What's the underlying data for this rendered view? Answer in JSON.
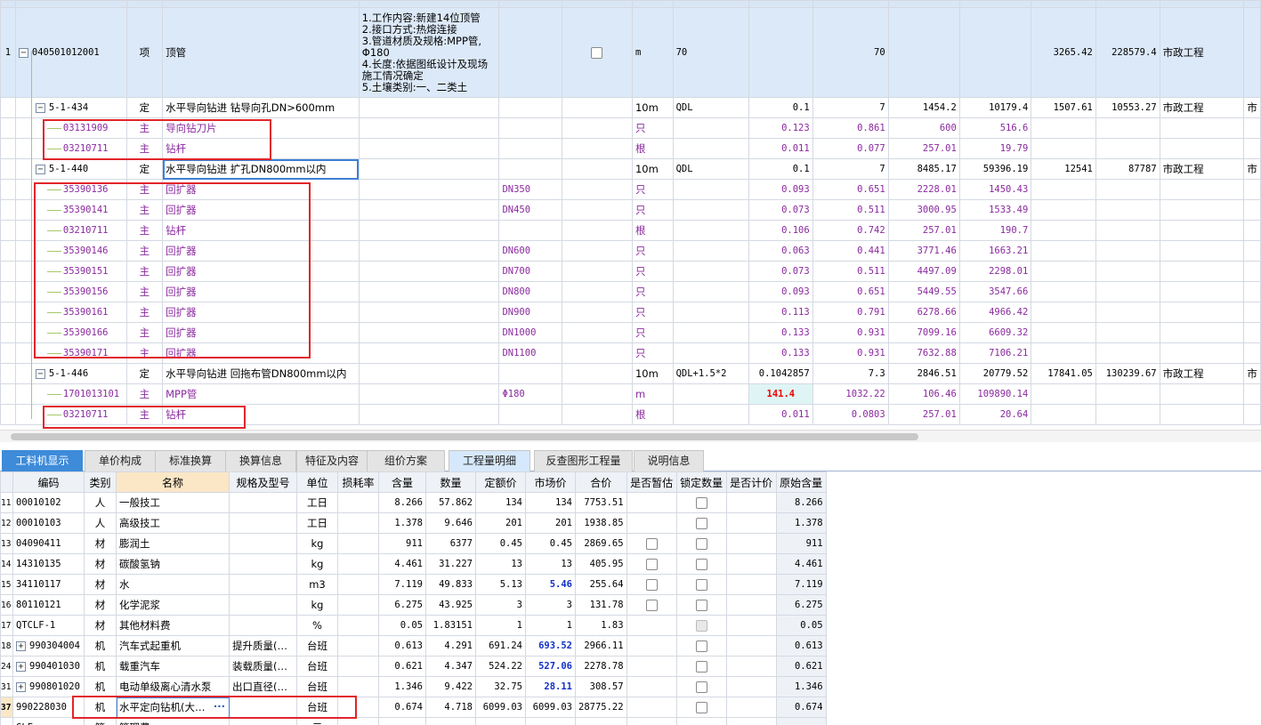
{
  "upper": {
    "main_row": {
      "idx": "1",
      "code": "040501012001",
      "type": "项",
      "name": "顶管",
      "desc": "1.工作内容:新建14位顶管\n2.接口方式:热熔连接\n3.管道材质及规格:MPP管,\nΦ180\n4.长度:依据图纸设计及现场\n施工情况确定\n5.土壤类别:一、二类土",
      "unit": "m",
      "expr": "70",
      "qty": "70",
      "p1": "3265.42",
      "p2": "228579.4",
      "cat": "市政工程"
    },
    "rows": [
      {
        "kind": "ding",
        "code": "5-1-434",
        "type": "定",
        "name": "水平导向钻进 钻导向孔DN>600mm",
        "spec": "",
        "unit": "10m",
        "expr": "QDL",
        "c1": "0.1",
        "c2": "7",
        "c3": "1454.2",
        "c4": "10179.4",
        "c5": "1507.61",
        "c6": "10553.27",
        "c7": "市政工程",
        "c8": "市"
      },
      {
        "kind": "zhu",
        "code": "03131909",
        "type": "主",
        "name": "导向钻刀片",
        "spec": "",
        "unit": "只",
        "c1": "0.123",
        "c2": "0.861",
        "c3": "600",
        "c4": "516.6"
      },
      {
        "kind": "zhu",
        "code": "03210711",
        "type": "主",
        "name": "钻杆",
        "spec": "",
        "unit": "根",
        "c1": "0.011",
        "c2": "0.077",
        "c3": "257.01",
        "c4": "19.79"
      },
      {
        "kind": "ding",
        "code": "5-1-440",
        "type": "定",
        "name": "水平导向钻进 扩孔DN800mm以内",
        "spec": "",
        "unit": "10m",
        "expr": "QDL",
        "c1": "0.1",
        "c2": "7",
        "c3": "8485.17",
        "c4": "59396.19",
        "c5": "12541",
        "c6": "87787",
        "c7": "市政工程",
        "c8": "市"
      },
      {
        "kind": "zhu",
        "code": "35390136",
        "type": "主",
        "name": "回扩器",
        "spec": "DN350",
        "unit": "只",
        "c1": "0.093",
        "c2": "0.651",
        "c3": "2228.01",
        "c4": "1450.43"
      },
      {
        "kind": "zhu",
        "code": "35390141",
        "type": "主",
        "name": "回扩器",
        "spec": "DN450",
        "unit": "只",
        "c1": "0.073",
        "c2": "0.511",
        "c3": "3000.95",
        "c4": "1533.49"
      },
      {
        "kind": "zhu",
        "code": "03210711",
        "type": "主",
        "name": "钻杆",
        "spec": "",
        "unit": "根",
        "c1": "0.106",
        "c2": "0.742",
        "c3": "257.01",
        "c4": "190.7"
      },
      {
        "kind": "zhu",
        "code": "35390146",
        "type": "主",
        "name": "回扩器",
        "spec": "DN600",
        "unit": "只",
        "c1": "0.063",
        "c2": "0.441",
        "c3": "3771.46",
        "c4": "1663.21"
      },
      {
        "kind": "zhu",
        "code": "35390151",
        "type": "主",
        "name": "回扩器",
        "spec": "DN700",
        "unit": "只",
        "c1": "0.073",
        "c2": "0.511",
        "c3": "4497.09",
        "c4": "2298.01"
      },
      {
        "kind": "zhu",
        "code": "35390156",
        "type": "主",
        "name": "回扩器",
        "spec": "DN800",
        "unit": "只",
        "c1": "0.093",
        "c2": "0.651",
        "c3": "5449.55",
        "c4": "3547.66"
      },
      {
        "kind": "zhu",
        "code": "35390161",
        "type": "主",
        "name": "回扩器",
        "spec": "DN900",
        "unit": "只",
        "c1": "0.113",
        "c2": "0.791",
        "c3": "6278.66",
        "c4": "4966.42"
      },
      {
        "kind": "zhu",
        "code": "35390166",
        "type": "主",
        "name": "回扩器",
        "spec": "DN1000",
        "unit": "只",
        "c1": "0.133",
        "c2": "0.931",
        "c3": "7099.16",
        "c4": "6609.32"
      },
      {
        "kind": "zhu",
        "code": "35390171",
        "type": "主",
        "name": "回扩器",
        "spec": "DN1100",
        "unit": "只",
        "c1": "0.133",
        "c2": "0.931",
        "c3": "7632.88",
        "c4": "7106.21"
      },
      {
        "kind": "ding",
        "code": "5-1-446",
        "type": "定",
        "name": "水平导向钻进 回拖布管DN800mm以内",
        "spec": "",
        "unit": "10m",
        "expr": "QDL+1.5*2",
        "c1": "0.1042857",
        "c2": "7.3",
        "c3": "2846.51",
        "c4": "20779.52",
        "c5": "17841.05",
        "c6": "130239.67",
        "c7": "市政工程",
        "c8": "市"
      },
      {
        "kind": "zhu",
        "code": "1701013101",
        "type": "主",
        "name": "MPP管",
        "spec": "Φ180",
        "unit": "m",
        "c1": "141.4",
        "c2": "1032.22",
        "c3": "106.46",
        "c4": "109890.14",
        "hl": true
      },
      {
        "kind": "zhu",
        "code": "03210711",
        "type": "主",
        "name": "钻杆",
        "spec": "",
        "unit": "根",
        "c1": "0.011",
        "c2": "0.0803",
        "c3": "257.01",
        "c4": "20.64"
      }
    ]
  },
  "tabs": [
    "工料机显示",
    "单价构成",
    "标准换算",
    "换算信息",
    "特征及内容",
    "组价方案",
    "工程量明细",
    "反查图形工程量",
    "说明信息"
  ],
  "lower": {
    "headers": [
      "编码",
      "类别",
      "名称",
      "规格及型号",
      "单位",
      "损耗率",
      "含量",
      "数量",
      "定额价",
      "市场价",
      "合价",
      "是否暂估",
      "锁定数量",
      "是否计价",
      "原始含量"
    ],
    "rows": [
      {
        "no": "11",
        "code": "00010102",
        "cat": "人",
        "name": "一般技工",
        "spec": "",
        "unit": "工日",
        "qty": "8.266",
        "num": "57.862",
        "dp": "134",
        "mp": "134",
        "total": "7753.51",
        "zg": false,
        "sd": true,
        "orig": "8.266"
      },
      {
        "no": "12",
        "code": "00010103",
        "cat": "人",
        "name": "高级技工",
        "spec": "",
        "unit": "工日",
        "qty": "1.378",
        "num": "9.646",
        "dp": "201",
        "mp": "201",
        "total": "1938.85",
        "zg": false,
        "sd": true,
        "orig": "1.378"
      },
      {
        "no": "13",
        "code": "04090411",
        "cat": "材",
        "name": "膨润土",
        "spec": "",
        "unit": "kg",
        "qty": "911",
        "num": "6377",
        "dp": "0.45",
        "mp": "0.45",
        "total": "2869.65",
        "zg": true,
        "sd": true,
        "orig": "911"
      },
      {
        "no": "14",
        "code": "14310135",
        "cat": "材",
        "name": "碳酸氢钠",
        "spec": "",
        "unit": "kg",
        "qty": "4.461",
        "num": "31.227",
        "dp": "13",
        "mp": "13",
        "total": "405.95",
        "zg": true,
        "sd": true,
        "orig": "4.461"
      },
      {
        "no": "15",
        "code": "34110117",
        "cat": "材",
        "name": "水",
        "spec": "",
        "unit": "m3",
        "qty": "7.119",
        "num": "49.833",
        "dp": "5.13",
        "mp": "5.46",
        "total": "255.64",
        "zg": true,
        "sd": true,
        "orig": "7.119",
        "blue": true
      },
      {
        "no": "16",
        "code": "80110121",
        "cat": "材",
        "name": "化学泥浆",
        "spec": "",
        "unit": "kg",
        "qty": "6.275",
        "num": "43.925",
        "dp": "3",
        "mp": "3",
        "total": "131.78",
        "zg": true,
        "sd": true,
        "orig": "6.275"
      },
      {
        "no": "17",
        "code": "QTCLF-1",
        "cat": "材",
        "name": "其他材料费",
        "spec": "",
        "unit": "%",
        "qty": "0.05",
        "num": "1.83151",
        "dp": "1",
        "mp": "1",
        "total": "1.83",
        "zg": false,
        "sd": "dis",
        "orig": "0.05"
      },
      {
        "no": "18",
        "code": "990304004",
        "cat": "机",
        "name": "汽车式起重机",
        "spec": "提升质量(…",
        "unit": "台班",
        "qty": "0.613",
        "num": "4.291",
        "dp": "691.24",
        "mp": "693.52",
        "total": "2966.11",
        "zg": false,
        "sd": true,
        "orig": "0.613",
        "blue": true,
        "plus": true
      },
      {
        "no": "24",
        "code": "990401030",
        "cat": "机",
        "name": "载重汽车",
        "spec": "装载质量(…",
        "unit": "台班",
        "qty": "0.621",
        "num": "4.347",
        "dp": "524.22",
        "mp": "527.06",
        "total": "2278.78",
        "zg": false,
        "sd": true,
        "orig": "0.621",
        "blue": true,
        "plus": true
      },
      {
        "no": "31",
        "code": "990801020",
        "cat": "机",
        "name": "电动单级离心清水泵",
        "spec": "出口直径(…",
        "unit": "台班",
        "qty": "1.346",
        "num": "9.422",
        "dp": "32.75",
        "mp": "28.11",
        "total": "308.57",
        "zg": false,
        "sd": true,
        "orig": "1.346",
        "blue": true,
        "plus": true
      },
      {
        "no": "37",
        "code": "990228030",
        "cat": "机",
        "name": "水平定向钻机(大…",
        "spec": "",
        "unit": "台班",
        "qty": "0.674",
        "num": "4.718",
        "dp": "6099.03",
        "mp": "6099.03",
        "total": "28775.22",
        "zg": false,
        "sd": true,
        "orig": "0.674",
        "sel": true
      },
      {
        "no": "",
        "code": "GLF",
        "cat": "管",
        "name": "管理费",
        "spec": "",
        "unit": "元",
        "qty": "",
        "num": "",
        "dp": "",
        "mp": "",
        "total": "",
        "zg": false,
        "sd": false,
        "orig": ""
      }
    ]
  }
}
